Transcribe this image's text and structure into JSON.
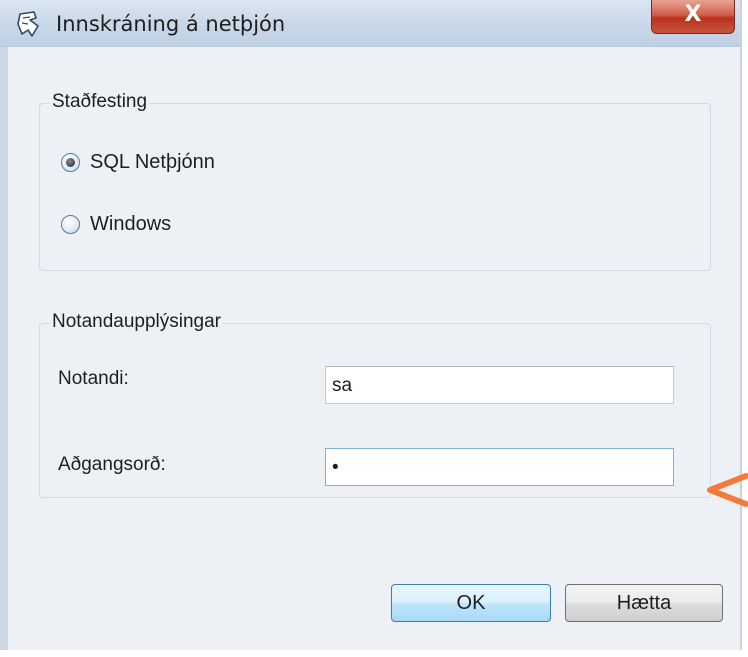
{
  "window": {
    "title": "Innskráning á netþjón",
    "close_glyph": "X",
    "icon": "app-logo-icon"
  },
  "authentication": {
    "legend": "Staðfesting",
    "options": [
      {
        "label": "SQL Netþjónn",
        "checked": true
      },
      {
        "label": "Windows",
        "checked": false
      }
    ]
  },
  "user_info": {
    "legend": "Notandaupplýsingar",
    "username_label": "Notandi:",
    "username_value": "sa",
    "password_label": "Aðgangsorð:",
    "password_value": "•"
  },
  "buttons": {
    "ok_label": "OK",
    "cancel_label": "Hætta"
  },
  "colors": {
    "accent_arrow": "#f47a3b",
    "close_button": "#c9553e"
  }
}
